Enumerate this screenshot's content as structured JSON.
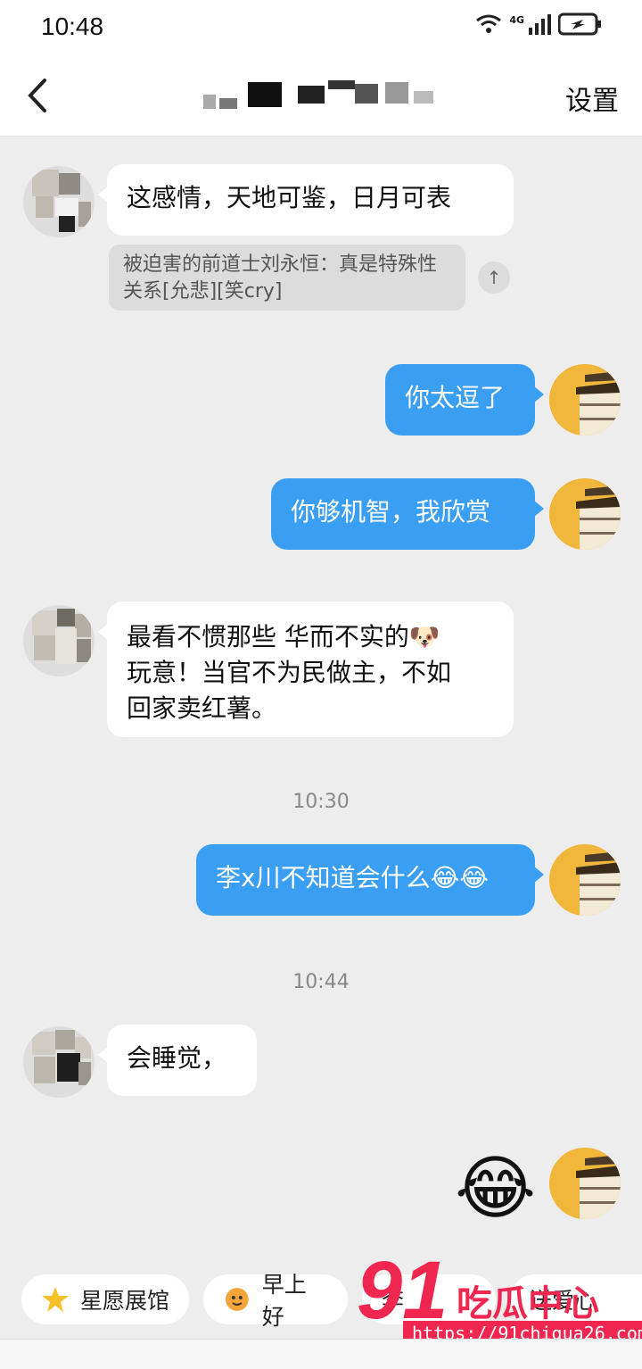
{
  "status_bar": {
    "time": "10:48",
    "network": "4G"
  },
  "header": {
    "back_icon": "chevron-left-icon",
    "settings_label": "设置"
  },
  "messages": [
    {
      "side": "in",
      "text": "这感情，天地可鉴，日月可表"
    },
    {
      "side": "in",
      "quote": "被迫害的前道士刘永恒：真是特殊性关系[允悲][笑cry]"
    },
    {
      "side": "out",
      "text": "你太逗了"
    },
    {
      "side": "out",
      "text": "你够机智，我欣赏"
    },
    {
      "side": "in",
      "text": "最看不惯那些 华而不实的🐶\n玩意！当官不为民做主，不如\n回家卖红薯。"
    },
    {
      "side": "out",
      "text": "李x川不知道会什么😂😂"
    },
    {
      "side": "in",
      "text": "会睡觉，"
    },
    {
      "side": "out",
      "emoji": "😂"
    }
  ],
  "timestamps": [
    "10:30",
    "10:44"
  ],
  "suggestions": [
    {
      "label": "星愿展馆",
      "icon": "star-icon"
    },
    {
      "label": "早上好",
      "icon": "sun-face-icon"
    },
    {
      "label": "李",
      "icon": ""
    },
    {
      "label": "送爱心",
      "icon": "heart-icon"
    }
  ],
  "watermark": {
    "number": "91",
    "text": "吃瓜中心",
    "url": "https://91chigua26.com"
  },
  "colors": {
    "bubble_out": "#3a9ef3",
    "bubble_in": "#ffffff",
    "background": "#ededed",
    "watermark": "#ef2750"
  }
}
